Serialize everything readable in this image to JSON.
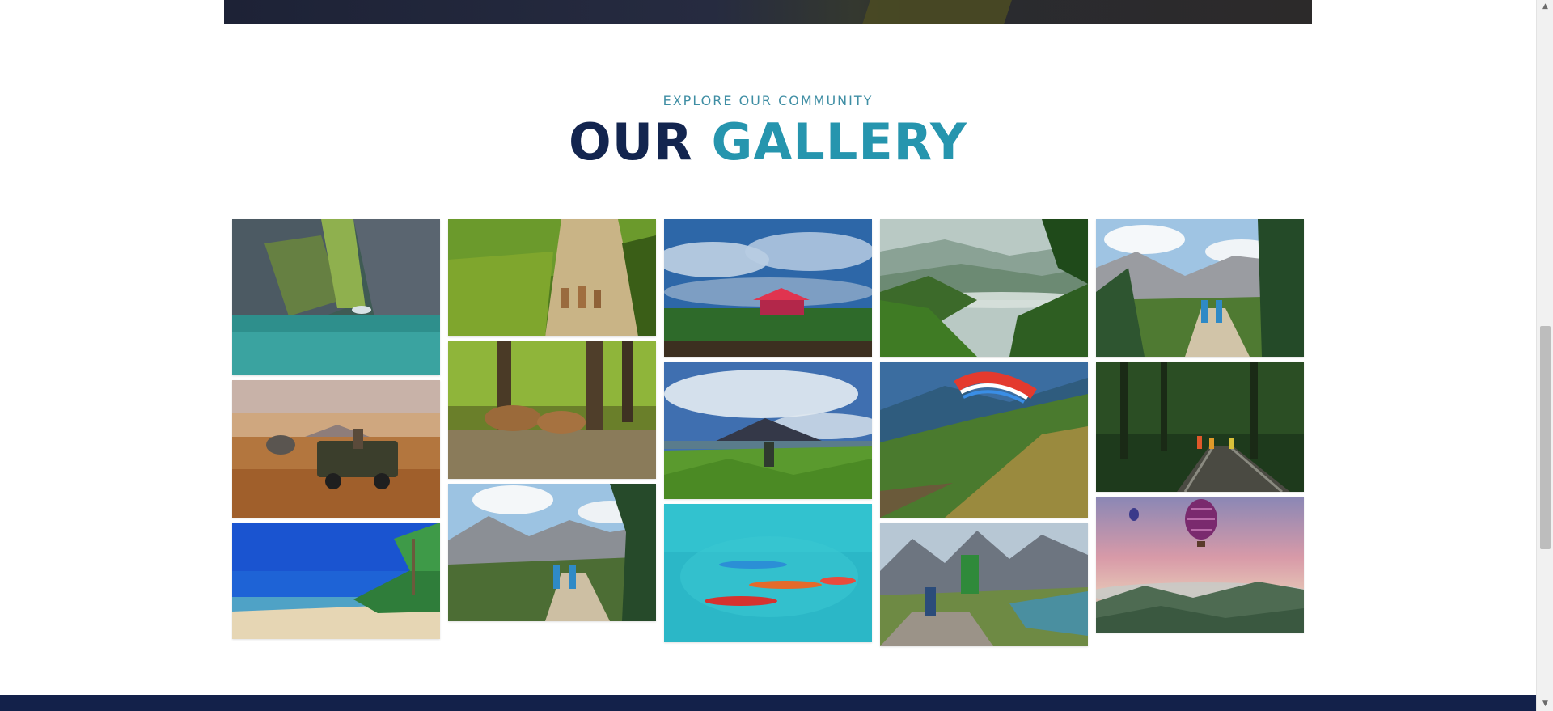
{
  "section": {
    "eyebrow": "EXPLORE OUR COMMUNITY",
    "title_part1": "OUR",
    "title_part2": "GALLERY"
  },
  "colors": {
    "title_dark": "#13254f",
    "title_accent": "#2695ae",
    "eyebrow": "#3f8ea4",
    "footer": "#13214a"
  },
  "gallery": {
    "photos": [
      "canyon-river",
      "safari-jeep-elephant",
      "tropical-beach",
      "deer-forest-path",
      "spotted-deer-grazing",
      "alpine-hikers-trail",
      "misty-valley-gazebo",
      "volcano-hiker-viewpoint",
      "turquoise-kayaks",
      "misty-tea-hills",
      "paraglider-slope",
      "mountain-trekkers-lake",
      "alpine-meadow-hikers",
      "forest-railway-walkers",
      "hot-air-balloons-sunset"
    ]
  }
}
